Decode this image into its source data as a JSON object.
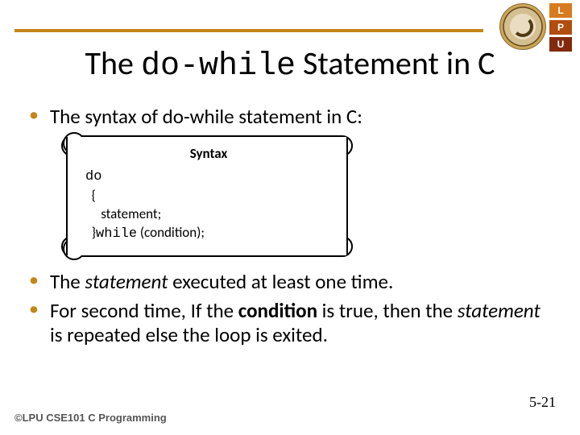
{
  "logo": {
    "L": "L",
    "P": "P",
    "U": "U"
  },
  "title": {
    "pre": "The ",
    "mono": "do-while",
    "post": " Statement in C"
  },
  "intro": {
    "text": "The syntax of do-while statement in C:"
  },
  "scroll": {
    "label": "Syntax",
    "code": {
      "l1_kw": "do",
      "l2": "  {",
      "l3": "     statement;",
      "l4_close": "  }",
      "l4_kw": "while",
      "l4_rest": " (condition);"
    }
  },
  "bullets": {
    "b1_pre": "The ",
    "b1_em": "statement",
    "b1_post": " executed at least one time.",
    "b2_pre": "For second time, If the ",
    "b2_bold": "condition",
    "b2_mid": " is true, then the ",
    "b2_em": "statement ",
    "b2_post": "is repeated else the loop is exited."
  },
  "footer": {
    "left": "©LPU CSE101 C Programming",
    "right": "5-21"
  }
}
